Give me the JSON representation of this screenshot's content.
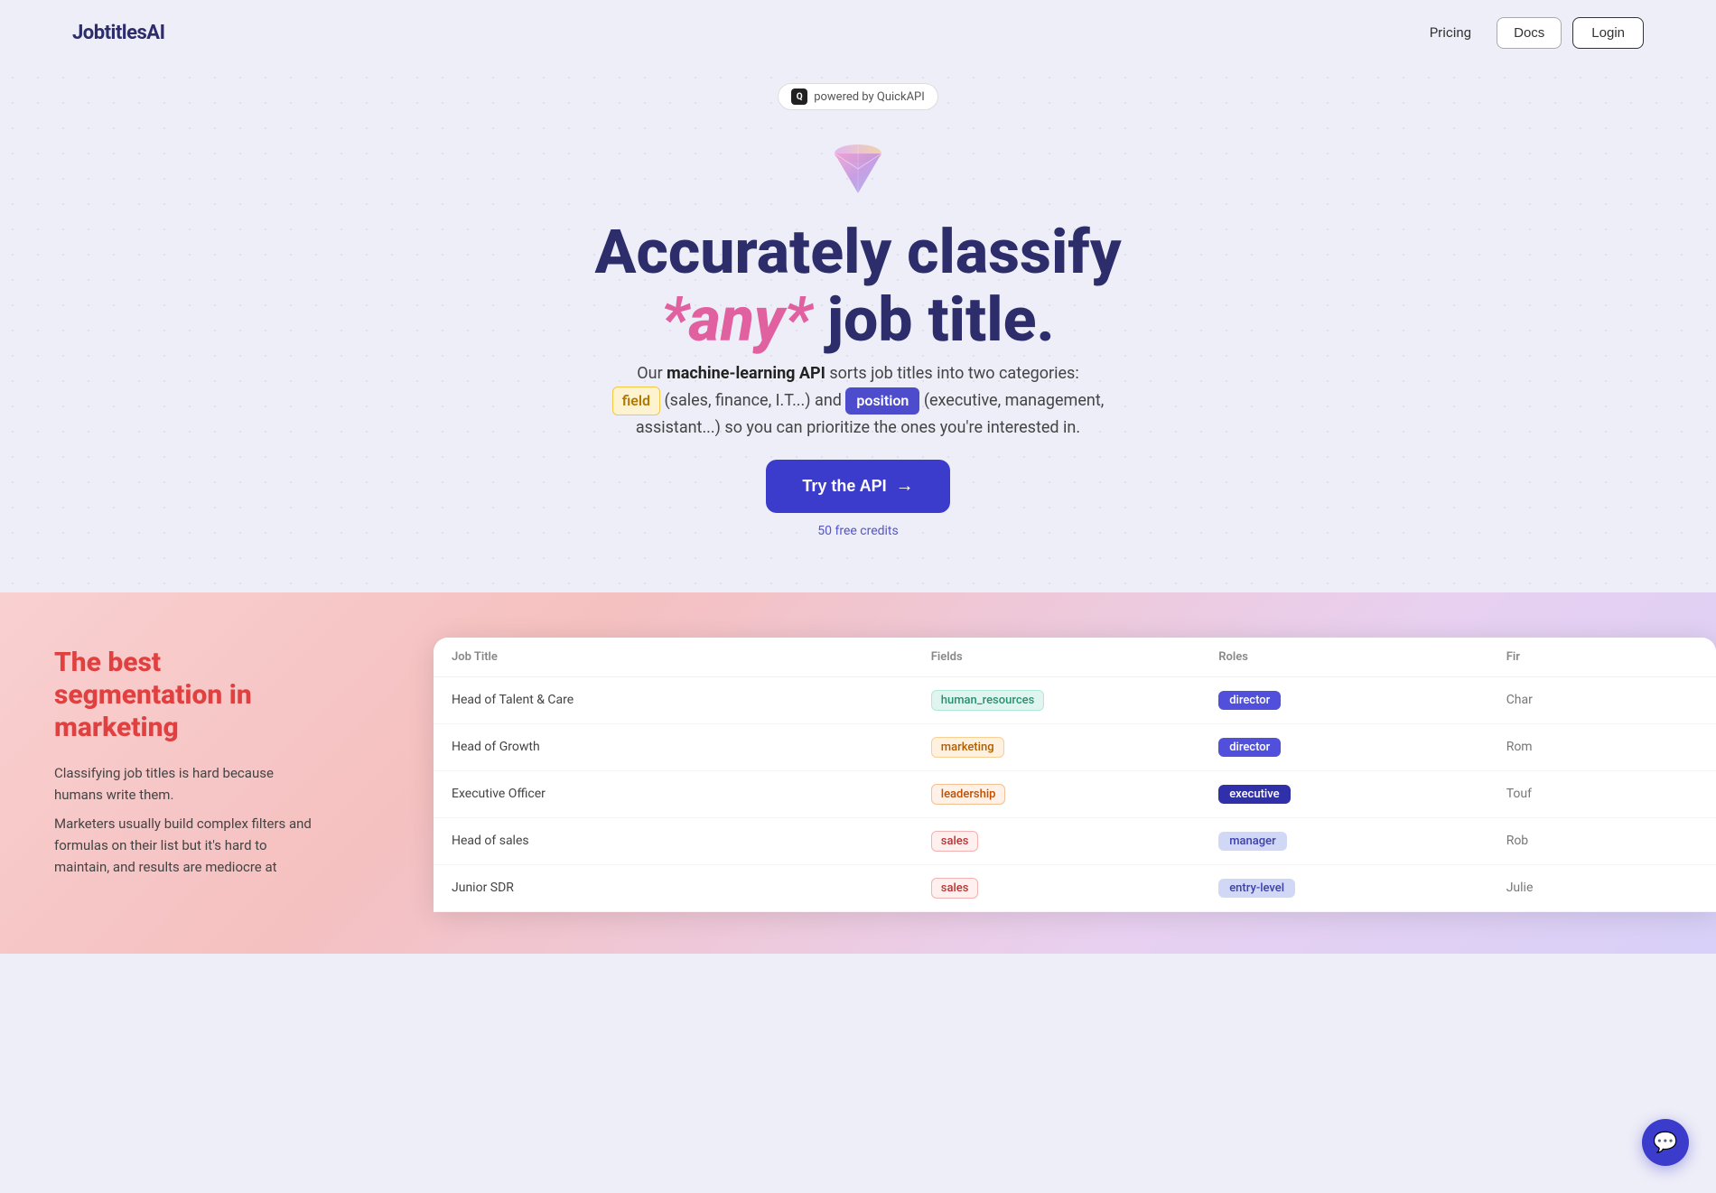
{
  "nav": {
    "logo": "JobtitlesAI",
    "pricing": "Pricing",
    "docs": "Docs",
    "login": "Login"
  },
  "hero": {
    "powered_by": "powered by QuickAPI",
    "title_line1": "Accurately classify",
    "title_any": "*any*",
    "title_line2": "job title.",
    "subtitle_prefix": "Our ",
    "subtitle_bold": "machine-learning API",
    "subtitle_mid": " sorts job titles into two categories:",
    "badge_field": "field",
    "field_desc": " (sales, finance, I.T...) and ",
    "badge_position": "position",
    "position_desc": " (executive, management, assistant...) so you can prioritize the ones you're interested in.",
    "cta_label": "Try the API",
    "cta_credits": "50 free credits"
  },
  "bottom": {
    "title": "The best segmentation in marketing",
    "desc1": "Classifying job titles is hard because humans write them.",
    "desc2": "Marketers usually build complex filters and formulas on their list but it's hard to maintain, and results are mediocre at"
  },
  "table": {
    "headers": [
      "Job Title",
      "Fields",
      "Roles",
      "Fir"
    ],
    "rows": [
      {
        "job_title": "Head of Talent & Care",
        "field": "human_resources",
        "field_class": "tag-hr",
        "role": "director",
        "role_class": "role-director",
        "first_name": "Char"
      },
      {
        "job_title": "Head of Growth",
        "field": "marketing",
        "field_class": "tag-marketing",
        "role": "director",
        "role_class": "role-director",
        "first_name": "Rom"
      },
      {
        "job_title": "Executive Officer",
        "field": "leadership",
        "field_class": "tag-leadership",
        "role": "executive",
        "role_class": "role-executive",
        "first_name": "Touf"
      },
      {
        "job_title": "Head of sales",
        "field": "sales",
        "field_class": "tag-sales",
        "role": "manager",
        "role_class": "role-manager",
        "first_name": "Rob"
      },
      {
        "job_title": "Junior SDR",
        "field": "sales",
        "field_class": "tag-sales",
        "role": "entry-level",
        "role_class": "role-entry",
        "first_name": "Julie"
      }
    ]
  }
}
